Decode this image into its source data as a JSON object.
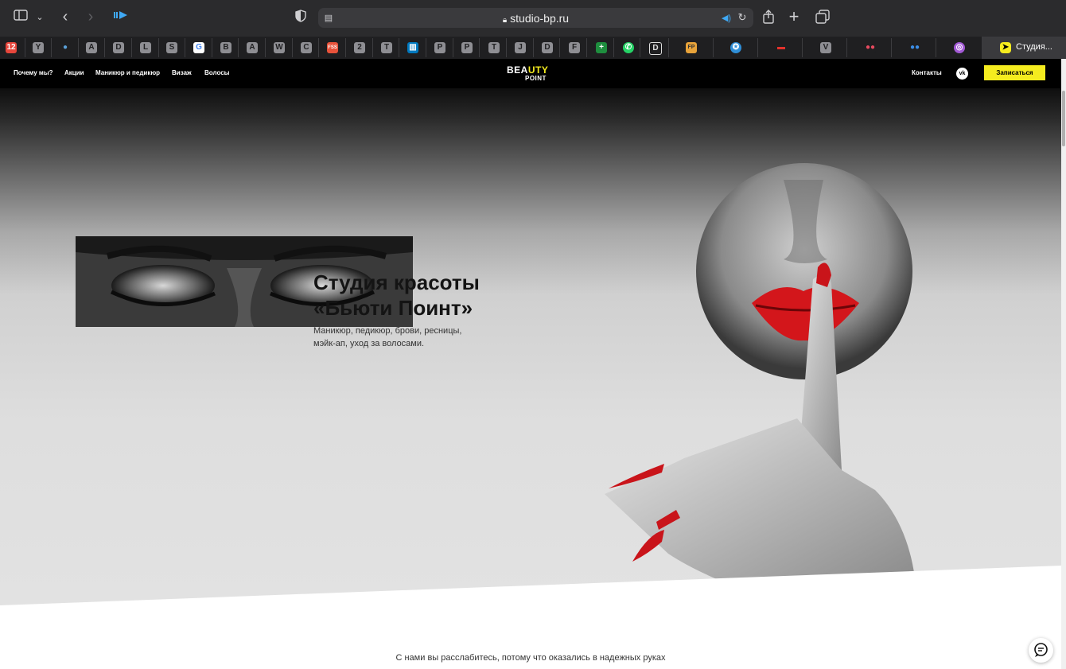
{
  "browser": {
    "url": "studio-bp.ru",
    "active_tab_label": "Студия...",
    "favorites": [
      "Y",
      "A",
      "D",
      "L",
      "S",
      "B",
      "A",
      "W",
      "C",
      "2",
      "T",
      "P",
      "P",
      "T",
      "J",
      "D",
      "F",
      "D",
      "V"
    ],
    "icons": [
      "sidebar-icon",
      "chevron-down-icon",
      "back-icon",
      "forward-icon",
      "media-icon",
      "shield-icon",
      "lock-icon",
      "speaker-icon",
      "reload-icon",
      "share-icon",
      "plus-icon",
      "tabs-icon"
    ]
  },
  "site": {
    "nav": [
      "Почему мы?",
      "Акции",
      "Маникюр и педикюр",
      "Визаж",
      "Волосы"
    ],
    "logo_top_a": "BEA",
    "logo_top_b": "UTY",
    "logo_bottom": "POINT",
    "contacts": "Контакты",
    "social": "vk",
    "signup": "Записаться",
    "accent_color": "#f5ec1f"
  },
  "hero": {
    "title_line1": "Студия красоты",
    "title_line2": "«Бьюти Поинт»",
    "subtitle": "Маникюр, педикюр, брови, ресницы, мэйк-ап, уход за волосами.",
    "tagline": "С нами вы расслабитесь, потому что оказались в надежных руках"
  }
}
